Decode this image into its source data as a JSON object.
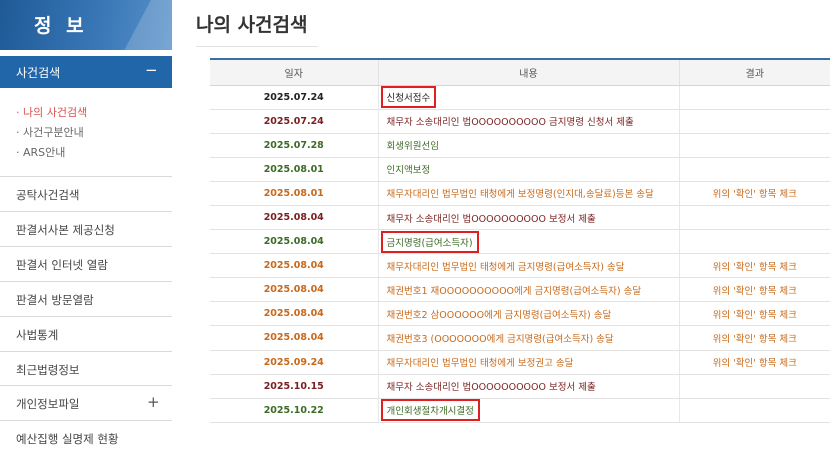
{
  "sidebar": {
    "title": "정 보",
    "active_menu": {
      "label": "사건검색",
      "toggle": "−"
    },
    "submenu": [
      {
        "label": "· 나의 사건검색",
        "active": true
      },
      {
        "label": "· 사건구분안내",
        "active": false
      },
      {
        "label": "· ARS안내",
        "active": false
      }
    ],
    "items": [
      {
        "label": "공탁사건검색",
        "toggle": ""
      },
      {
        "label": "판결서사본 제공신청",
        "toggle": ""
      },
      {
        "label": "판결서 인터넷 열람",
        "toggle": ""
      },
      {
        "label": "판결서 방문열람",
        "toggle": ""
      },
      {
        "label": "사법통계",
        "toggle": ""
      },
      {
        "label": "최근법령정보",
        "toggle": ""
      },
      {
        "label": "개인정보파일",
        "toggle": "+"
      },
      {
        "label": "예산집행 실명제 현황",
        "toggle": ""
      }
    ]
  },
  "page": {
    "title": "나의 사건검색"
  },
  "table": {
    "headers": [
      "일자",
      "내용",
      "결과"
    ],
    "rows": [
      {
        "date": "2025.07.24",
        "content": "신청서접수",
        "result": "",
        "color": "dark",
        "highlighted": true
      },
      {
        "date": "2025.07.24",
        "content": "채무자 소송대리인 법OOOOOOOOOO 금지명령 신청서 제출",
        "result": "",
        "color": "maroon",
        "highlighted": false
      },
      {
        "date": "2025.07.28",
        "content": "회생위원선임",
        "result": "",
        "color": "green",
        "highlighted": false
      },
      {
        "date": "2025.08.01",
        "content": "인지액보정",
        "result": "",
        "color": "green",
        "highlighted": false
      },
      {
        "date": "2025.08.01",
        "content": "채무자대리인 법무법인 태청에게 보정명령(인지대,송달료)등본 송달",
        "result": "위의 '확인' 항목 체크",
        "color": "orange",
        "highlighted": false
      },
      {
        "date": "2025.08.04",
        "content": "채무자 소송대리인 법OOOOOOOOOO 보정서 제출",
        "result": "",
        "color": "maroon",
        "highlighted": false
      },
      {
        "date": "2025.08.04",
        "content": "금지명령(급여소득자)",
        "result": "",
        "color": "green",
        "highlighted": true
      },
      {
        "date": "2025.08.04",
        "content": "채무자대리인 법무법인 태청에게 금지명령(급여소득자) 송달",
        "result": "위의 '확인' 항목 체크",
        "color": "orange",
        "highlighted": false
      },
      {
        "date": "2025.08.04",
        "content": "채권번호1 재OOOOOOOOOO에게 금지명령(급여소득자) 송달",
        "result": "위의 '확인' 항목 체크",
        "color": "orange",
        "highlighted": false
      },
      {
        "date": "2025.08.04",
        "content": "채권번호2 삼OOOOOO에게 금지명령(급여소득자) 송달",
        "result": "위의 '확인' 항목 체크",
        "color": "orange",
        "highlighted": false
      },
      {
        "date": "2025.08.04",
        "content": "채권번호3 (OOOOOOO에게 금지명령(급여소득자) 송달",
        "result": "위의 '확인' 항목 체크",
        "color": "orange",
        "highlighted": false
      },
      {
        "date": "2025.09.24",
        "content": "채무자대리인 법무법인 태청에게 보정권고 송달",
        "result": "위의 '확인' 항목 체크",
        "color": "orange",
        "highlighted": false
      },
      {
        "date": "2025.10.15",
        "content": "채무자 소송대리인 법OOOOOOOOOO 보정서 제출",
        "result": "",
        "color": "maroon",
        "highlighted": false
      },
      {
        "date": "2025.10.22",
        "content": "개인회생절차개시결정",
        "result": "",
        "color": "green",
        "highlighted": true
      }
    ]
  },
  "colors": {
    "brand_blue": "#2166a8",
    "highlight_red": "#e02020",
    "text_maroon": "#7a1f1f",
    "text_green": "#3d6b26",
    "text_orange": "#c8691a"
  }
}
